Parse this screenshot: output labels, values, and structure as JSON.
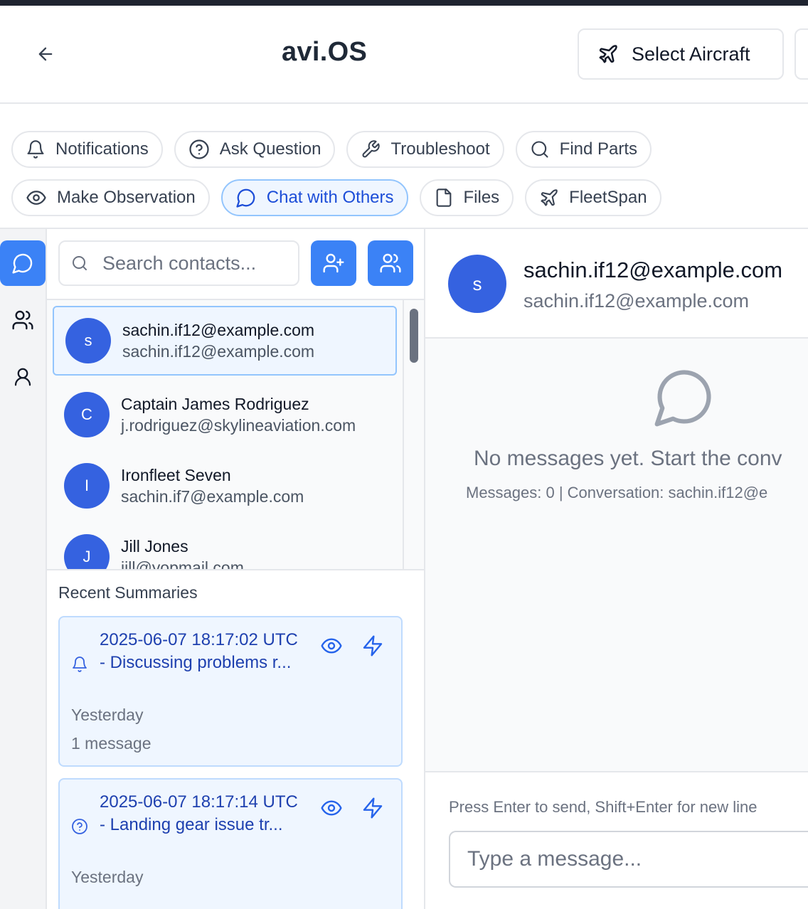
{
  "header": {
    "title": "avi.OS",
    "select_aircraft_label": "Select Aircraft"
  },
  "actions": {
    "row1": [
      {
        "label": "Notifications",
        "icon": "bell-icon"
      },
      {
        "label": "Ask Question",
        "icon": "help-circle-icon"
      },
      {
        "label": "Troubleshoot",
        "icon": "wrench-icon"
      },
      {
        "label": "Find Parts",
        "icon": "search-icon"
      }
    ],
    "row2": [
      {
        "label": "Make Observation",
        "icon": "eye-icon"
      },
      {
        "label": "Chat with Others",
        "icon": "chat-icon",
        "active": true
      },
      {
        "label": "Files",
        "icon": "file-icon"
      },
      {
        "label": "FleetSpan",
        "icon": "plane-icon"
      }
    ]
  },
  "contacts": {
    "search_placeholder": "Search contacts...",
    "items": [
      {
        "initial": "s",
        "name": "sachin.if12@example.com",
        "email": "sachin.if12@example.com",
        "selected": true
      },
      {
        "initial": "C",
        "name": "Captain James Rodriguez",
        "email": "j.rodriguez@skylineaviation.com"
      },
      {
        "initial": "I",
        "name": "Ironfleet Seven",
        "email": "sachin.if7@example.com"
      },
      {
        "initial": "J",
        "name": "Jill Jones",
        "email": "jill@yopmail.com"
      }
    ]
  },
  "summaries": {
    "title": "Recent Summaries",
    "items": [
      {
        "icon": "bell-icon",
        "title": "2025-06-07 18:17:02 UTC - Discussing problems r...",
        "when": "Yesterday",
        "count": "1 message"
      },
      {
        "icon": "help-circle-icon",
        "title": "2025-06-07 18:17:14 UTC - Landing gear issue tr...",
        "when": "Yesterday"
      }
    ]
  },
  "chat": {
    "avatar_initial": "s",
    "name": "sachin.if12@example.com",
    "subtitle": "sachin.if12@example.com",
    "empty_text": "No messages yet. Start the conv",
    "empty_meta": "Messages: 0 | Conversation: sachin.if12@e",
    "hint": "Press Enter to send, Shift+Enter for new line",
    "input_placeholder": "Type a message..."
  },
  "colors": {
    "accent": "#3b82f6",
    "avatar": "#3562e0",
    "active_chip_bg": "#eff6ff",
    "summary_title": "#1e40af"
  }
}
